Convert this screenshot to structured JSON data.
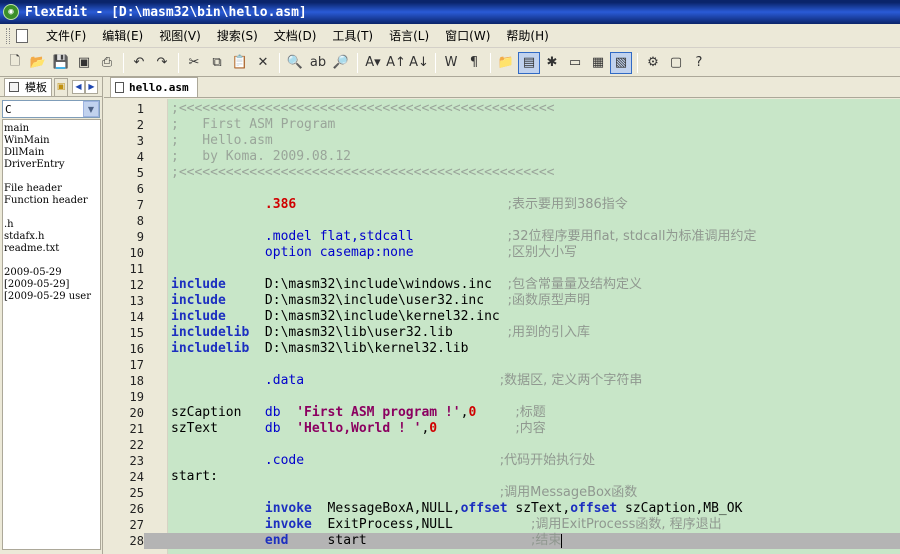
{
  "window": {
    "title": "FlexEdit - [D:\\masm32\\bin\\hello.asm]"
  },
  "menu": [
    "文件(F)",
    "编辑(E)",
    "视图(V)",
    "搜索(S)",
    "文档(D)",
    "工具(T)",
    "语言(L)",
    "窗口(W)",
    "帮助(H)"
  ],
  "left_panel": {
    "tab_label": "模板",
    "language_select": "C",
    "items": [
      "main",
      "WinMain",
      "DllMain",
      "DriverEntry",
      "",
      "File header",
      "Function header",
      "",
      ".h",
      "stdafx.h",
      "readme.txt",
      "",
      "2009-05-29",
      "[2009-05-29]",
      "[2009-05-29 user"
    ]
  },
  "editor": {
    "tab_label": "hello.asm",
    "lines": [
      {
        "n": "1",
        "parts": [
          {
            "c": "c-comment",
            "t": ";<<<<<<<<<<<<<<<<<<<<<<<<<<<<<<<<<<<<<<<<<<<<<<<<"
          }
        ]
      },
      {
        "n": "2",
        "parts": [
          {
            "c": "c-comment",
            "t": ";   First ASM Program"
          }
        ]
      },
      {
        "n": "3",
        "parts": [
          {
            "c": "c-comment",
            "t": ";   Hello.asm"
          }
        ]
      },
      {
        "n": "4",
        "parts": [
          {
            "c": "c-comment",
            "t": ";   by Koma. 2009.08.12"
          }
        ]
      },
      {
        "n": "5",
        "parts": [
          {
            "c": "c-comment",
            "t": ";<<<<<<<<<<<<<<<<<<<<<<<<<<<<<<<<<<<<<<<<<<<<<<<<"
          }
        ]
      },
      {
        "n": "6",
        "parts": []
      },
      {
        "n": "7",
        "parts": [
          {
            "c": "c-plain",
            "t": "            "
          },
          {
            "c": "c-red",
            "t": ".386"
          },
          {
            "c": "c-plain",
            "t": "                           "
          },
          {
            "c": "c-cn",
            "t": ";表示要用到386指令"
          }
        ]
      },
      {
        "n": "8",
        "parts": []
      },
      {
        "n": "9",
        "parts": [
          {
            "c": "c-plain",
            "t": "            "
          },
          {
            "c": "c-dir",
            "t": ".model flat,stdcall"
          },
          {
            "c": "c-plain",
            "t": "            "
          },
          {
            "c": "c-cn",
            "t": ";32位程序要用flat, stdcall为标准调用约定"
          }
        ]
      },
      {
        "n": "10",
        "parts": [
          {
            "c": "c-plain",
            "t": "            "
          },
          {
            "c": "c-dir",
            "t": "option casemap:none"
          },
          {
            "c": "c-plain",
            "t": "            "
          },
          {
            "c": "c-cn",
            "t": ";区别大小写"
          }
        ]
      },
      {
        "n": "11",
        "parts": []
      },
      {
        "n": "12",
        "parts": [
          {
            "c": "c-kw",
            "t": "include"
          },
          {
            "c": "c-plain",
            "t": "     D:\\masm32\\include\\windows.inc  "
          },
          {
            "c": "c-cn",
            "t": ";包含常量量及结构定义"
          }
        ]
      },
      {
        "n": "13",
        "parts": [
          {
            "c": "c-kw",
            "t": "include"
          },
          {
            "c": "c-plain",
            "t": "     D:\\masm32\\include\\user32.inc   "
          },
          {
            "c": "c-cn",
            "t": ";函数原型声明"
          }
        ]
      },
      {
        "n": "14",
        "parts": [
          {
            "c": "c-kw",
            "t": "include"
          },
          {
            "c": "c-plain",
            "t": "     D:\\masm32\\include\\kernel32.inc"
          }
        ]
      },
      {
        "n": "15",
        "parts": [
          {
            "c": "c-kw",
            "t": "includelib"
          },
          {
            "c": "c-plain",
            "t": "  D:\\masm32\\lib\\user32.lib       "
          },
          {
            "c": "c-cn",
            "t": ";用到的引入库"
          }
        ]
      },
      {
        "n": "16",
        "parts": [
          {
            "c": "c-kw",
            "t": "includelib"
          },
          {
            "c": "c-plain",
            "t": "  D:\\masm32\\lib\\kernel32.lib"
          }
        ]
      },
      {
        "n": "17",
        "parts": []
      },
      {
        "n": "18",
        "parts": [
          {
            "c": "c-plain",
            "t": "            "
          },
          {
            "c": "c-dir",
            "t": ".data"
          },
          {
            "c": "c-plain",
            "t": "                         "
          },
          {
            "c": "c-cn",
            "t": ";数据区, 定义两个字符串"
          }
        ]
      },
      {
        "n": "19",
        "parts": []
      },
      {
        "n": "20",
        "parts": [
          {
            "c": "c-plain",
            "t": "szCaption   "
          },
          {
            "c": "c-dir",
            "t": "db"
          },
          {
            "c": "c-plain",
            "t": "  "
          },
          {
            "c": "c-str",
            "t": "'First ASM program !'"
          },
          {
            "c": "c-plain",
            "t": ","
          },
          {
            "c": "c-num",
            "t": "0"
          },
          {
            "c": "c-plain",
            "t": "     "
          },
          {
            "c": "c-cn",
            "t": ";标题"
          }
        ]
      },
      {
        "n": "21",
        "parts": [
          {
            "c": "c-plain",
            "t": "szText      "
          },
          {
            "c": "c-dir",
            "t": "db"
          },
          {
            "c": "c-plain",
            "t": "  "
          },
          {
            "c": "c-str",
            "t": "'Hello,World ! '"
          },
          {
            "c": "c-plain",
            "t": ","
          },
          {
            "c": "c-num",
            "t": "0"
          },
          {
            "c": "c-plain",
            "t": "          "
          },
          {
            "c": "c-cn",
            "t": ";内容"
          }
        ]
      },
      {
        "n": "22",
        "parts": []
      },
      {
        "n": "23",
        "parts": [
          {
            "c": "c-plain",
            "t": "            "
          },
          {
            "c": "c-dir",
            "t": ".code"
          },
          {
            "c": "c-plain",
            "t": "                         "
          },
          {
            "c": "c-cn",
            "t": ";代码开始执行处"
          }
        ]
      },
      {
        "n": "24",
        "parts": [
          {
            "c": "c-plain",
            "t": "start:"
          }
        ]
      },
      {
        "n": "25",
        "parts": [
          {
            "c": "c-plain",
            "t": "                                          "
          },
          {
            "c": "c-cn",
            "t": ";调用MessageBox函数"
          }
        ]
      },
      {
        "n": "26",
        "parts": [
          {
            "c": "c-plain",
            "t": "            "
          },
          {
            "c": "c-kw",
            "t": "invoke"
          },
          {
            "c": "c-plain",
            "t": "  MessageBoxA,NULL,"
          },
          {
            "c": "c-kw",
            "t": "offset"
          },
          {
            "c": "c-plain",
            "t": " szText,"
          },
          {
            "c": "c-kw",
            "t": "offset"
          },
          {
            "c": "c-plain",
            "t": " szCaption,MB_OK"
          }
        ]
      },
      {
        "n": "27",
        "parts": [
          {
            "c": "c-plain",
            "t": "            "
          },
          {
            "c": "c-kw",
            "t": "invoke"
          },
          {
            "c": "c-plain",
            "t": "  ExitProcess,NULL          "
          },
          {
            "c": "c-cn",
            "t": ";调用ExitProcess函数, 程序退出"
          }
        ]
      },
      {
        "n": "28",
        "parts": [
          {
            "c": "c-plain",
            "t": "            "
          },
          {
            "c": "c-kw",
            "t": "end"
          },
          {
            "c": "c-plain",
            "t": "     start                     "
          },
          {
            "c": "c-cn",
            "t": ";结束"
          }
        ],
        "current": true
      }
    ]
  }
}
